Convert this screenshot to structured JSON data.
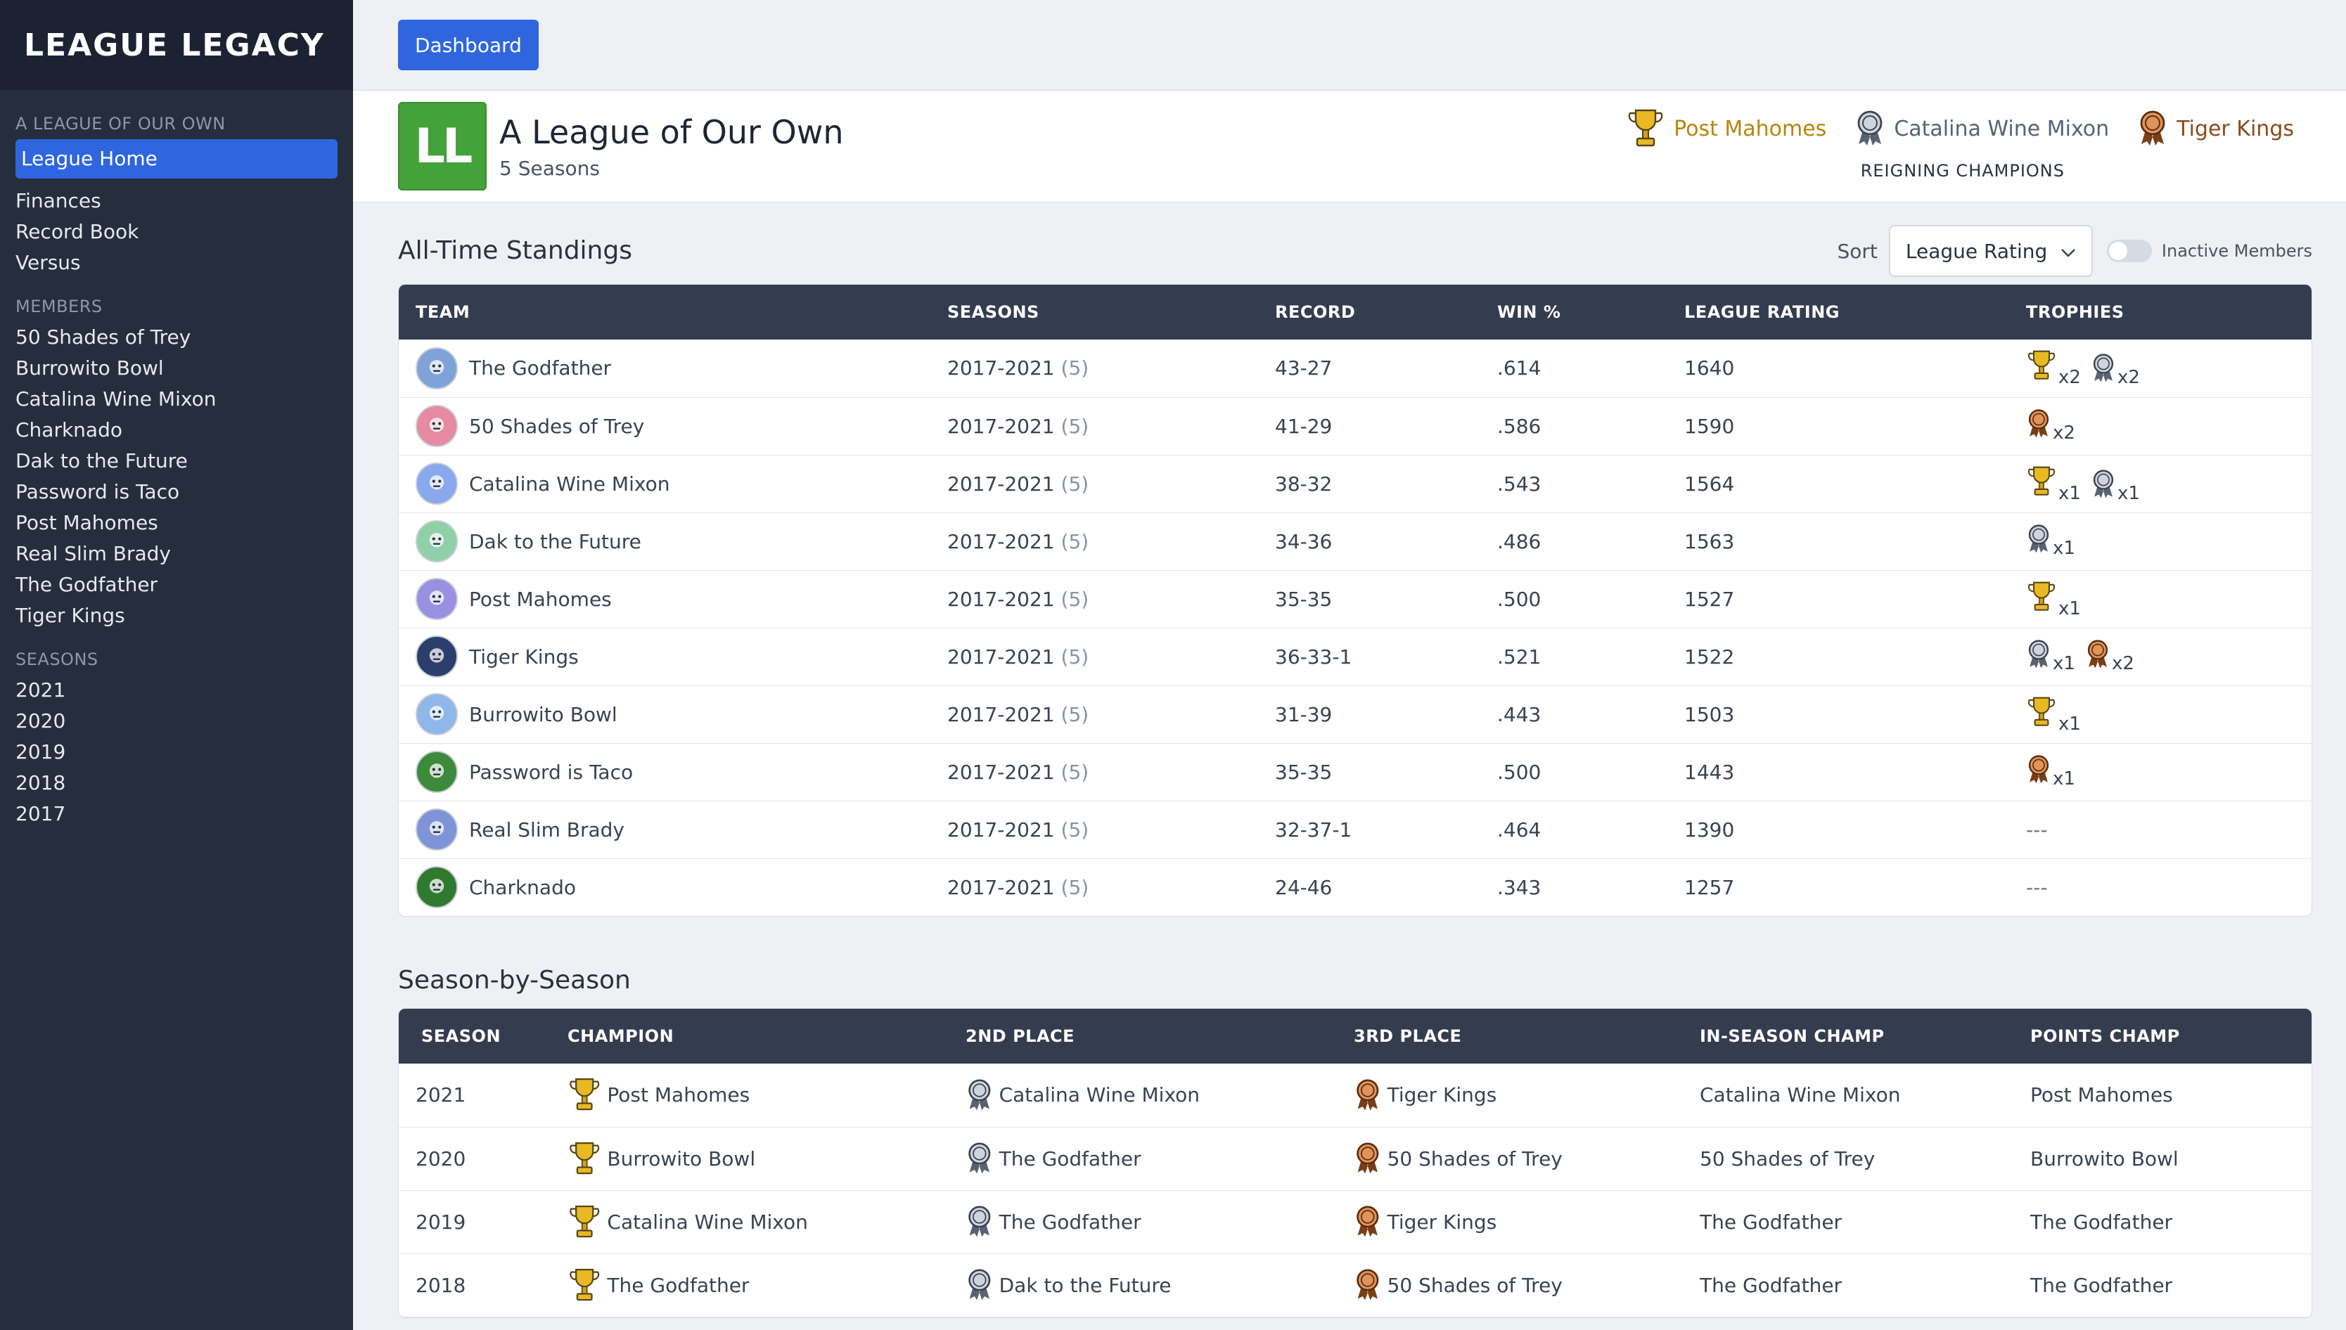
{
  "app": {
    "logo": "LEAGUE LEGACY"
  },
  "sidebar": {
    "league_heading": "A LEAGUE OF OUR OWN",
    "league_items": [
      {
        "label": "League Home",
        "active": true
      },
      {
        "label": "Finances"
      },
      {
        "label": "Record Book"
      },
      {
        "label": "Versus"
      }
    ],
    "members_heading": "MEMBERS",
    "members": [
      "50 Shades of Trey",
      "Burrowito Bowl",
      "Catalina Wine Mixon",
      "Charknado",
      "Dak to the Future",
      "Password is Taco",
      "Post Mahomes",
      "Real Slim Brady",
      "The Godfather",
      "Tiger Kings"
    ],
    "seasons_heading": "SEASONS",
    "seasons": [
      "2021",
      "2020",
      "2019",
      "2018",
      "2017"
    ]
  },
  "topbar": {
    "dashboard_label": "Dashboard"
  },
  "league": {
    "logo_text": "LL",
    "title": "A League of Our Own",
    "subtitle": "5 Seasons",
    "champions": {
      "first": "Post Mahomes",
      "second": "Catalina Wine Mixon",
      "third": "Tiger Kings",
      "label": "REIGNING CHAMPIONS"
    }
  },
  "standings": {
    "title": "All-Time Standings",
    "sort_label": "Sort",
    "sort_value": "League Rating",
    "toggle_label": "Inactive Members",
    "columns": [
      "TEAM",
      "SEASONS",
      "RECORD",
      "WIN %",
      "LEAGUE RATING",
      "TROPHIES"
    ],
    "rows": [
      {
        "team": "The Godfather",
        "seasons": "2017-2021",
        "count": "(5)",
        "record": "43-27",
        "win": ".614",
        "rating": "1640",
        "avatar": "#7fa3d9",
        "trophies": [
          {
            "type": "gold",
            "mult": "x2"
          },
          {
            "type": "silver",
            "mult": "x2"
          }
        ]
      },
      {
        "team": "50 Shades of Trey",
        "seasons": "2017-2021",
        "count": "(5)",
        "record": "41-29",
        "win": ".586",
        "rating": "1590",
        "avatar": "#e58aa0",
        "trophies": [
          {
            "type": "bronze",
            "mult": "x2"
          }
        ]
      },
      {
        "team": "Catalina Wine Mixon",
        "seasons": "2017-2021",
        "count": "(5)",
        "record": "38-32",
        "win": ".543",
        "rating": "1564",
        "avatar": "#8aa8ee",
        "trophies": [
          {
            "type": "gold",
            "mult": "x1"
          },
          {
            "type": "silver",
            "mult": "x1"
          }
        ]
      },
      {
        "team": "Dak to the Future",
        "seasons": "2017-2021",
        "count": "(5)",
        "record": "34-36",
        "win": ".486",
        "rating": "1563",
        "avatar": "#8fd0a8",
        "trophies": [
          {
            "type": "silver",
            "mult": "x1"
          }
        ]
      },
      {
        "team": "Post Mahomes",
        "seasons": "2017-2021",
        "count": "(5)",
        "record": "35-35",
        "win": ".500",
        "rating": "1527",
        "avatar": "#9a8fe0",
        "trophies": [
          {
            "type": "gold",
            "mult": "x1"
          }
        ]
      },
      {
        "team": "Tiger Kings",
        "seasons": "2017-2021",
        "count": "(5)",
        "record": "36-33-1",
        "win": ".521",
        "rating": "1522",
        "avatar": "#2c3e6b",
        "trophies": [
          {
            "type": "silver",
            "mult": "x1"
          },
          {
            "type": "bronze",
            "mult": "x2"
          }
        ]
      },
      {
        "team": "Burrowito Bowl",
        "seasons": "2017-2021",
        "count": "(5)",
        "record": "31-39",
        "win": ".443",
        "rating": "1503",
        "avatar": "#8fb7e8",
        "trophies": [
          {
            "type": "gold",
            "mult": "x1"
          }
        ]
      },
      {
        "team": "Password is Taco",
        "seasons": "2017-2021",
        "count": "(5)",
        "record": "35-35",
        "win": ".500",
        "rating": "1443",
        "avatar": "#3c8a3a",
        "trophies": [
          {
            "type": "bronze",
            "mult": "x1"
          }
        ]
      },
      {
        "team": "Real Slim Brady",
        "seasons": "2017-2021",
        "count": "(5)",
        "record": "32-37-1",
        "win": ".464",
        "rating": "1390",
        "avatar": "#7f93d8",
        "trophies": [],
        "empty": "---"
      },
      {
        "team": "Charknado",
        "seasons": "2017-2021",
        "count": "(5)",
        "record": "24-46",
        "win": ".343",
        "rating": "1257",
        "avatar": "#2f7a2e",
        "trophies": [],
        "empty": "---"
      }
    ]
  },
  "seasons_table": {
    "title": "Season-by-Season",
    "columns": [
      "SEASON",
      "CHAMPION",
      "2ND PLACE",
      "3RD PLACE",
      "IN-SEASON CHAMP",
      "POINTS CHAMP"
    ],
    "rows": [
      {
        "season": "2021",
        "champion": "Post Mahomes",
        "second": "Catalina Wine Mixon",
        "third": "Tiger Kings",
        "in_season": "Catalina Wine Mixon",
        "points": "Post Mahomes"
      },
      {
        "season": "2020",
        "champion": "Burrowito Bowl",
        "second": "The Godfather",
        "third": "50 Shades of Trey",
        "in_season": "50 Shades of Trey",
        "points": "Burrowito Bowl"
      },
      {
        "season": "2019",
        "champion": "Catalina Wine Mixon",
        "second": "The Godfather",
        "third": "Tiger Kings",
        "in_season": "The Godfather",
        "points": "The Godfather"
      },
      {
        "season": "2018",
        "champion": "The Godfather",
        "second": "Dak to the Future",
        "third": "50 Shades of Trey",
        "in_season": "The Godfather",
        "points": "The Godfather"
      }
    ]
  },
  "colors": {
    "accent": "#2f66e0",
    "sidebar": "#262d3d",
    "gold": "#d4a017",
    "silver": "#7a8494",
    "bronze": "#c0733a"
  }
}
